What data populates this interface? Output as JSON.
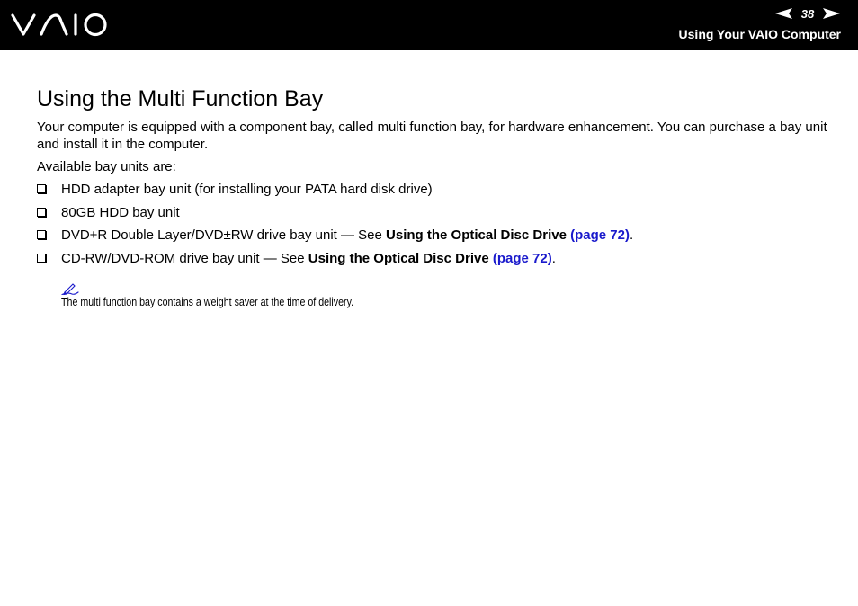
{
  "header": {
    "logo_text": "VAIO",
    "page_number": "38",
    "section_title": "Using Your VAIO Computer"
  },
  "main": {
    "title": "Using the Multi Function Bay",
    "intro": "Your computer is equipped with a component bay, called multi function bay, for hardware enhancement. You can purchase a bay unit and install it in the computer.",
    "available_label": "Available bay units are:",
    "items": [
      {
        "text": "HDD adapter bay unit (for installing your PATA hard disk drive)"
      },
      {
        "text": "80GB HDD bay unit"
      },
      {
        "text": "DVD+R Double Layer/DVD±RW drive bay unit — See ",
        "ref": "Using the Optical Disc Drive",
        "link": "(page 72)",
        "end": "."
      },
      {
        "text": "CD-RW/DVD-ROM drive bay unit — See ",
        "ref": "Using the Optical Disc Drive",
        "link": "(page 72)",
        "end": "."
      }
    ],
    "note": "The multi function bay contains a weight saver at the time of delivery."
  },
  "colors": {
    "header_bg": "#000000",
    "link": "#1a1acc"
  },
  "icons": [
    "vaio-logo",
    "previous-page-arrow-icon",
    "next-page-arrow-icon",
    "checkbox-bullet-icon",
    "pencil-note-icon"
  ]
}
